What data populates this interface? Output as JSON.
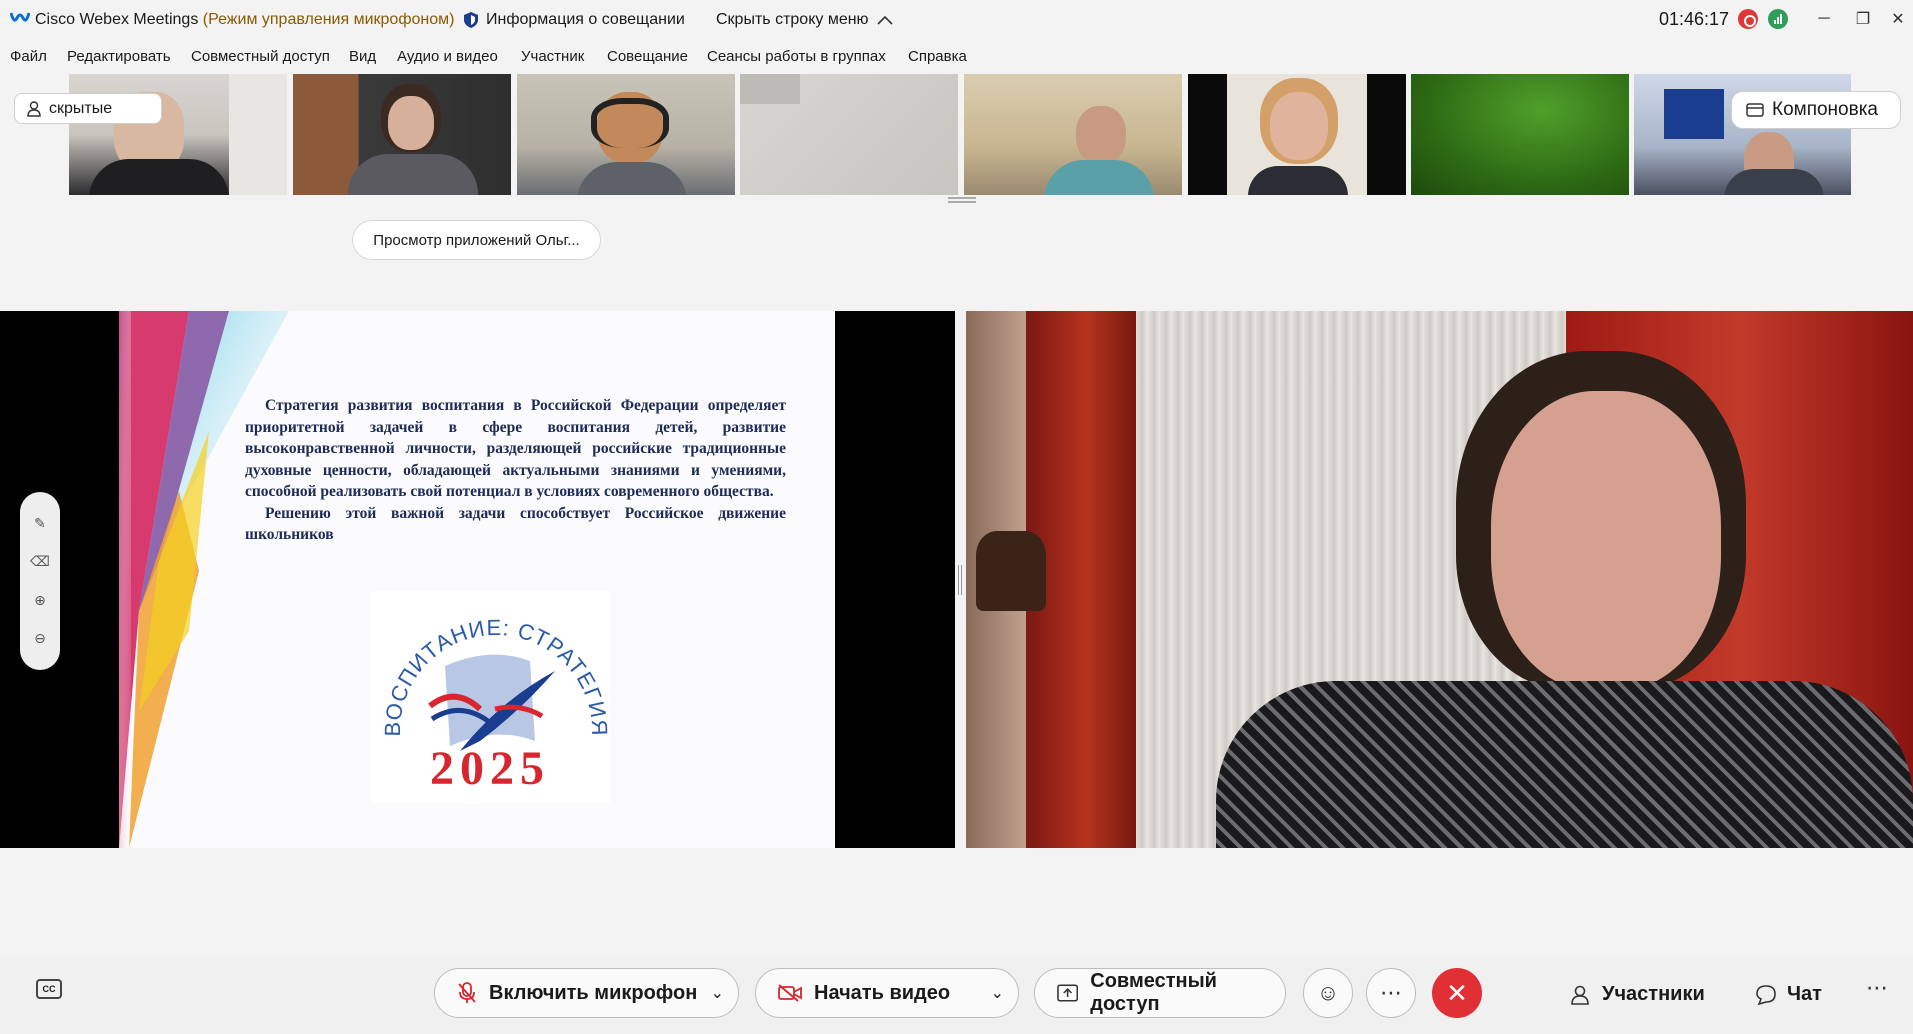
{
  "titlebar": {
    "app_name": "Cisco Webex Meetings",
    "mode": "(Режим управления микрофоном)",
    "meeting_info": "Информация о совещании",
    "hide_menu": "Скрыть строку меню",
    "time": "01:46:17",
    "minimize": "─",
    "restore": "❐",
    "close": "✕"
  },
  "menu": [
    "Файл",
    "Редактировать",
    "Совместный доступ",
    "Вид",
    "Аудио и видео",
    "Участник",
    "Совещание",
    "Сеансы работы в группах",
    "Справка"
  ],
  "filmstrip": {
    "hidden_label": "скрытые",
    "layout_label": "Компоновка",
    "apps_label": "Просмотр приложений Ольг..."
  },
  "slide": {
    "paragraph1": "Стратегия развития воспитания в Российской Федерации определяет приоритетной задачей в сфере воспитания детей, развитие высоконравственной личности, разделяющей российские традиционные духовные ценности, обладающей актуальными знаниями и умениями, способной реализовать свой потенциал в условиях современного общества.",
    "paragraph2": "Решению этой важной задачи способствует Российское движение школьников",
    "logo_arc": "ВОСПИТАНИЕ: СТРАТЕГИЯ",
    "logo_year": "2025"
  },
  "toolbar": {
    "mic_label": "Включить микрофон",
    "video_label": "Начать видео",
    "share_label": "Совместный доступ",
    "participants_label": "Участники",
    "chat_label": "Чат",
    "cc_label": "CC"
  },
  "colors": {
    "end_call": "#e03035",
    "recording": "#e03838",
    "network": "#2f9e5a",
    "slide_text": "#1d2a55",
    "logo_red": "#d7262e"
  }
}
